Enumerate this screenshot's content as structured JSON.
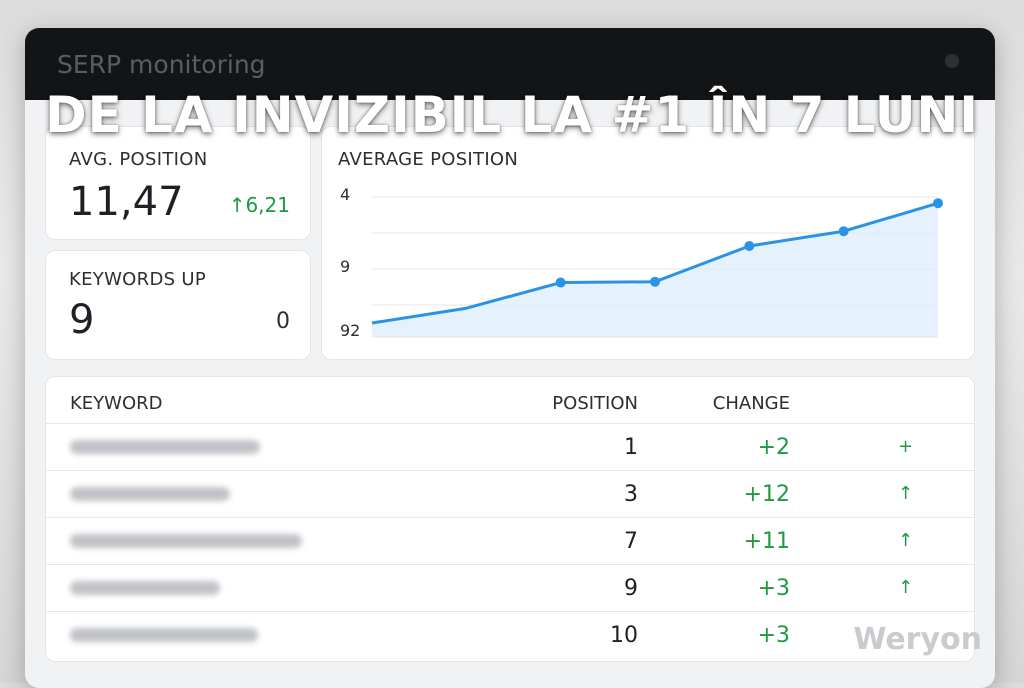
{
  "app": {
    "title": "SERP monitoring"
  },
  "overlay": {
    "headline": "DE LA INVIZIBIL LA #1 ÎN 7 LUNI"
  },
  "watermark": "Weryon",
  "kpi_avg": {
    "label": "AVG. POSITION",
    "value": "11,47",
    "delta": "↑6,21"
  },
  "kpi_keywords": {
    "label": "KEYWORDS UP",
    "value": "9",
    "side_value": "0"
  },
  "chart_data": {
    "type": "line",
    "title": "AVERAGE POSITION",
    "y_ticks": [
      "4",
      "9",
      "92"
    ],
    "x": [
      1,
      2,
      3,
      4,
      5,
      6,
      7
    ],
    "values": [
      18.2,
      16.3,
      13.0,
      12.9,
      8.3,
      6.4,
      2.8
    ],
    "markers": [
      false,
      false,
      true,
      true,
      true,
      true,
      true
    ],
    "series_color": "#2a93e6",
    "fill_color": "#dcecfb",
    "grid": true
  },
  "table": {
    "headers": {
      "keyword": "KEYWORD",
      "position": "POSITION",
      "change": "CHANGE"
    },
    "rows": [
      {
        "position": "1",
        "change": "+2",
        "indicator": "+"
      },
      {
        "position": "3",
        "change": "+12",
        "indicator": "↑"
      },
      {
        "position": "7",
        "change": "+11",
        "indicator": "↑"
      },
      {
        "position": "9",
        "change": "+3",
        "indicator": "↑"
      },
      {
        "position": "10",
        "change": "+3",
        "indicator": ""
      }
    ]
  },
  "colors": {
    "positive": "#1f9a42",
    "titlebar": "#121416"
  }
}
